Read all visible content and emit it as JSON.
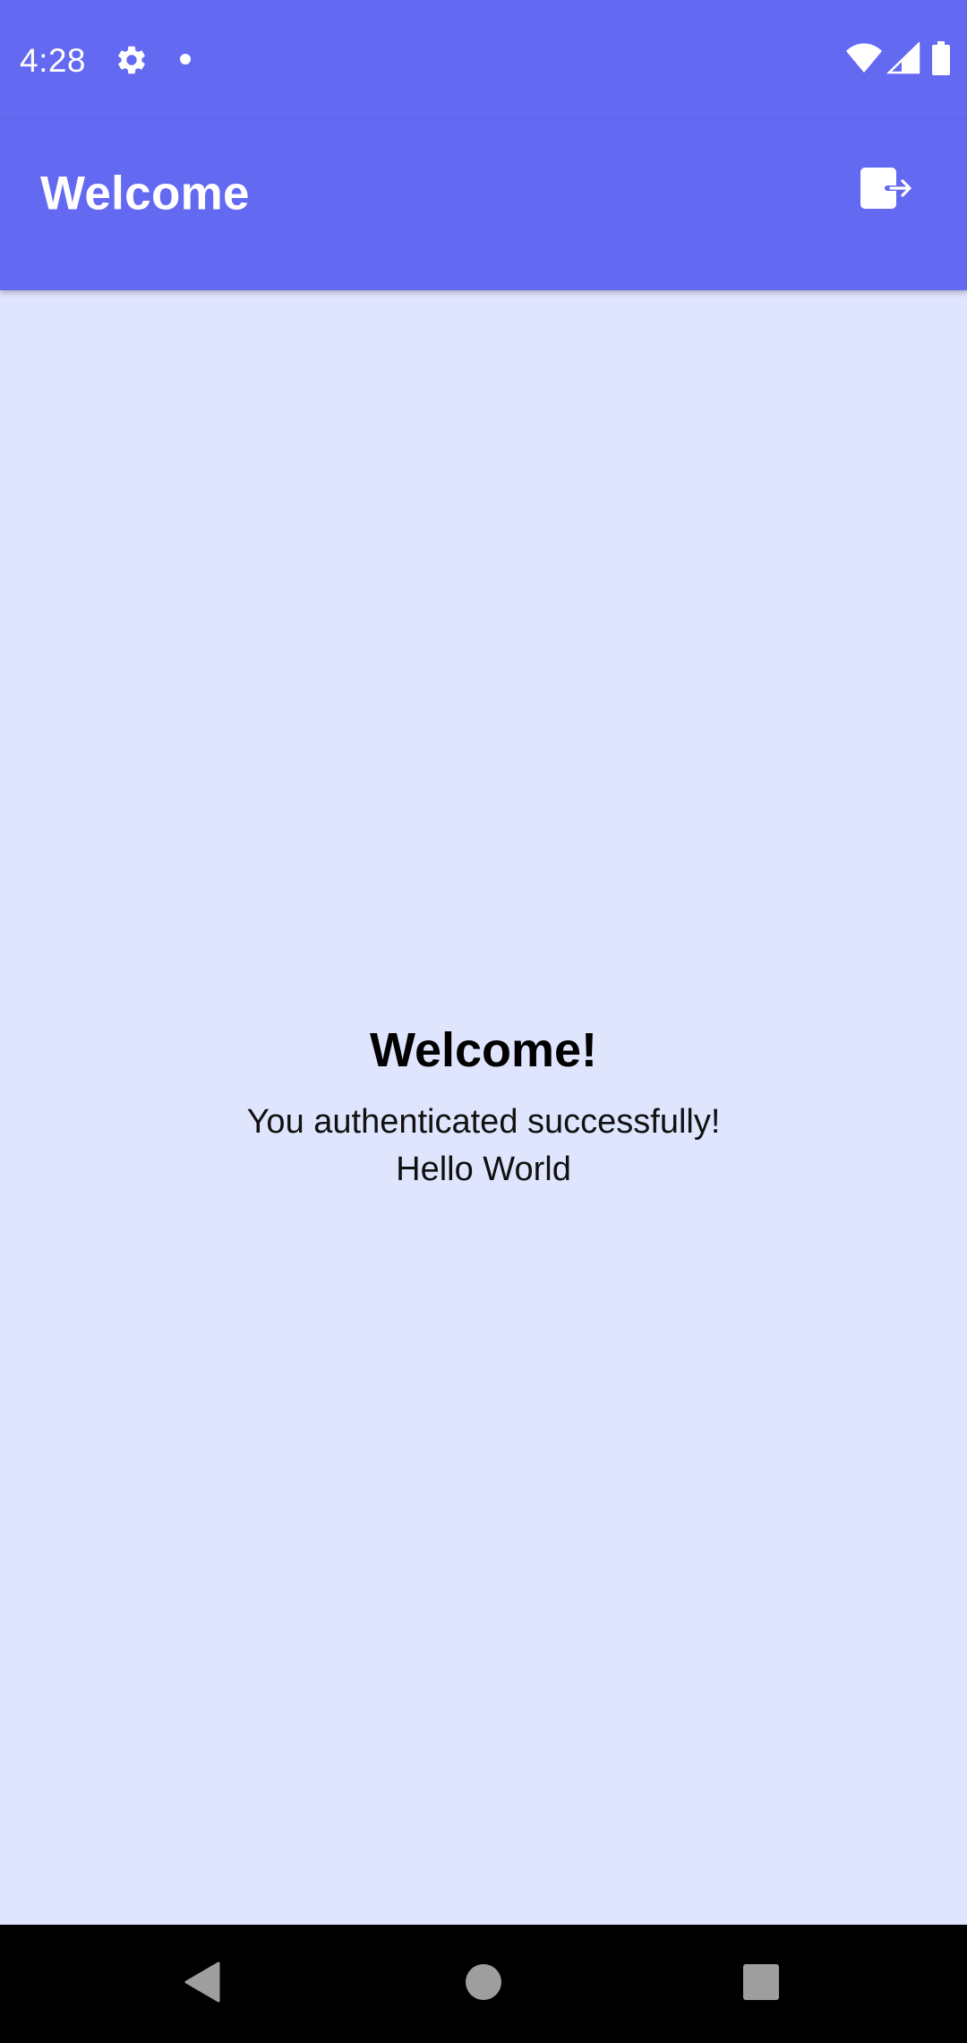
{
  "status_bar": {
    "time": "4:28",
    "icons": [
      "settings-gear-icon",
      "notification-dot-icon",
      "wifi-icon",
      "cell-signal-icon",
      "battery-icon"
    ]
  },
  "app_bar": {
    "title": "Welcome",
    "action_icon": "logout-icon"
  },
  "main": {
    "heading": "Welcome!",
    "message": "You authenticated successfully!",
    "greeting": "Hello World"
  },
  "nav_bar": {
    "buttons": [
      "back",
      "home",
      "recents"
    ]
  },
  "colors": {
    "primary": "#6469F2",
    "background": "#E0E5FE",
    "on_primary": "#FFFFFF",
    "nav_background": "#000000"
  }
}
